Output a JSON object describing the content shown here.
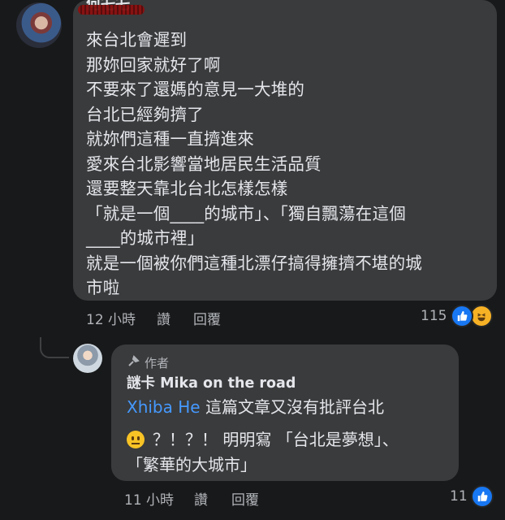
{
  "comment": {
    "author": "何乇乇",
    "lines": [
      "來台北會遲到",
      "那妳回家就好了啊",
      "不要來了還媽的意見一大堆的",
      "台北已經夠擠了",
      "就妳們這種一直擠進來",
      "愛來台北影響當地居民生活品質",
      "還要整天靠北台北怎樣怎樣",
      "「就是一個____的城市」、「獨自飄蕩在這個",
      "____的城市裡」",
      "就是一個被你們這種北漂仔搞得擁擠不堪的城",
      "市啦"
    ],
    "time": "12 小時",
    "like_label": "讚",
    "reply_label": "回覆",
    "reaction_count": "115",
    "reaction_icons": [
      "like-icon",
      "haha-icon"
    ]
  },
  "reply": {
    "badge_icon": "microphone-icon",
    "badge_label": "作者",
    "author": "謎卡 Mika on the road",
    "mention": "Xhiba He",
    "line1_rest": " 這篇文章又沒有批評台北",
    "emoji": "neutral-face-emoji",
    "line2_rest": "？！？！ 明明寫 「台北是夢想」、",
    "line3": "「繁華的大城市」",
    "time": "11 小時",
    "like_label": "讚",
    "reply_label": "回覆",
    "reaction_count": "11",
    "reaction_icons": [
      "like-icon"
    ]
  },
  "colors": {
    "background": "#18191a",
    "bubble": "#3a3b3c",
    "text": "#e4e6eb",
    "secondary_text": "#b0b3b8",
    "link": "#4599ff",
    "like_blue": "#1877f2"
  }
}
